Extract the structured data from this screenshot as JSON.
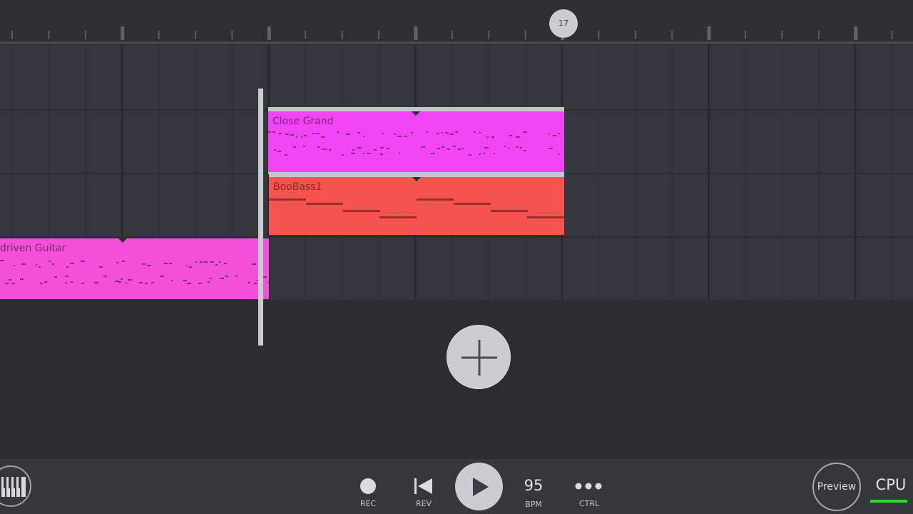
{
  "ruler": {
    "marker_label": "17"
  },
  "patterns": [
    {
      "id": "close-grand",
      "label": "Close Grand",
      "color": "#f044f5"
    },
    {
      "id": "boobass",
      "label": "BooBass1",
      "color": "#f4534f"
    },
    {
      "id": "guitar",
      "label": "driven Guitar",
      "color": "#f44fd8"
    }
  ],
  "toolbar": {
    "rec_label": "REC",
    "rev_label": "REV",
    "bpm_value": "95",
    "bpm_label": "BPM",
    "ctrl_label": "CTRL",
    "preview_label": "Preview",
    "cpu_label": "CPU",
    "cpu_level": 1.0
  },
  "colors": {
    "background": "#2a2d32",
    "grid": "#34373d",
    "cpu_meter": "#2fd62f"
  }
}
